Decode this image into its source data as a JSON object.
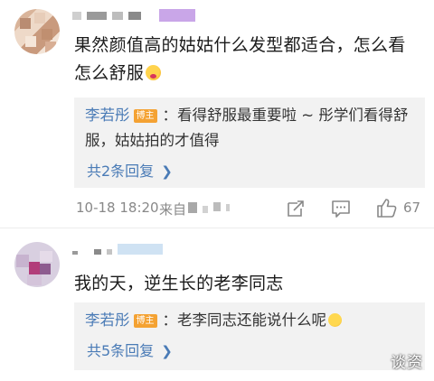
{
  "comments": [
    {
      "text": "果然颜值高的姑姑什么发型都适合，怎么看怎么舒服",
      "emoji": "astonished-face-emoji",
      "reply": {
        "author": "李若彤",
        "badge": "博主",
        "text": "：看得舒服最重要啦 ~ 彤学们看得舒服，姑姑拍的才值得"
      },
      "more_replies": "共2条回复",
      "time": "10-18 18:20",
      "source_prefix": "来自",
      "like_count": "67"
    },
    {
      "text": "我的天，逆生长的老李同志",
      "reply": {
        "author": "李若彤",
        "badge": "博主",
        "text": "：老李同志还能说什么呢",
        "emoji": "laughing-face-emoji"
      },
      "more_replies": "共5条回复"
    }
  ],
  "watermark": "谈资",
  "icons": {
    "share": "share-icon",
    "comment": "comment-icon",
    "like": "thumbs-up-icon",
    "chevron": "chevron-right-icon"
  },
  "colors": {
    "link": "#4a7bb6",
    "badge": "#f4a233",
    "reply_bg": "#f2f2f2",
    "meta": "#888888"
  }
}
